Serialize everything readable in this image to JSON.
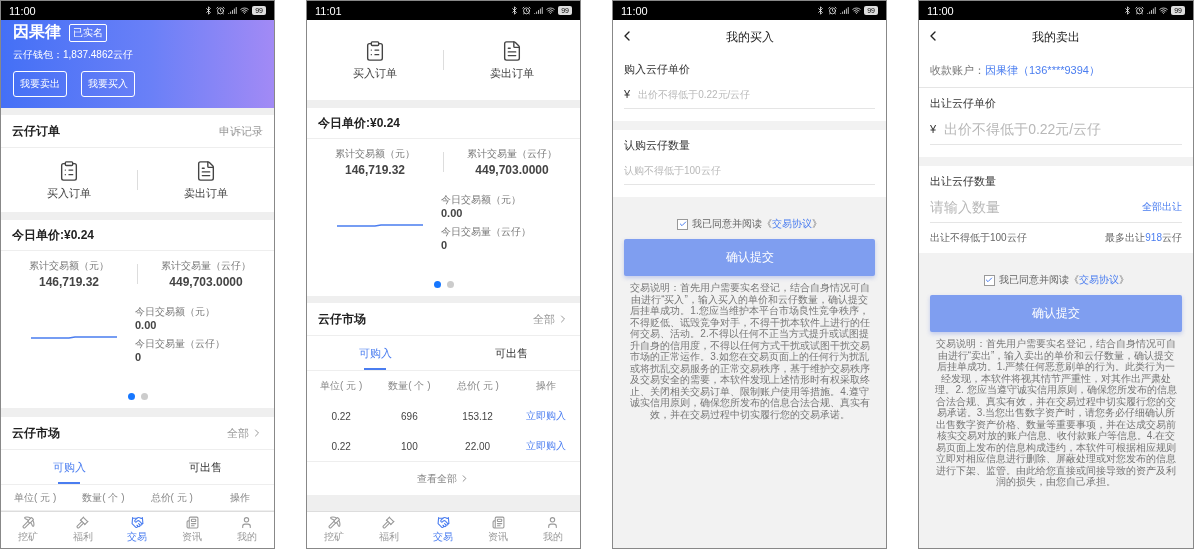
{
  "phones": [
    {
      "kind": "home",
      "time": "11:00",
      "battery": "99",
      "profile": {
        "name": "因果律",
        "badge": "已实名",
        "wallet": "云仔钱包：1,837.4862云仔",
        "buttons": [
          "我要卖出",
          "我要买入"
        ]
      },
      "orders": {
        "title": "云仔订单",
        "link": "申诉记录",
        "items": [
          "买入订单",
          "卖出订单"
        ]
      },
      "price": "今日单价:¥0.24",
      "stats": {
        "totals": [
          {
            "label": "累计交易额（元）",
            "value": "146,719.32"
          },
          {
            "label": "累计交易量（云仔）",
            "value": "449,703.0000"
          }
        ],
        "today": [
          {
            "label": "今日交易额（元）",
            "value": "0.00"
          },
          {
            "label": "今日交易量（云仔）",
            "value": "0"
          }
        ],
        "pager": [
          {
            "selected": true
          },
          {
            "selected": false
          }
        ]
      },
      "market": {
        "title": "云仔市场",
        "link": "全部",
        "tabs": [
          {
            "label": "可购入",
            "selected": true
          },
          {
            "label": "可出售",
            "selected": false
          }
        ],
        "columns": [
          "单位( 元 )",
          "数量( 个 )",
          "总价( 元 )",
          "操作"
        ]
      },
      "tabbar": [
        {
          "label": "挖矿",
          "selected": false
        },
        {
          "label": "福利",
          "selected": false
        },
        {
          "label": "交易",
          "selected": true
        },
        {
          "label": "资讯",
          "selected": false
        },
        {
          "label": "我的",
          "selected": false
        }
      ]
    },
    {
      "kind": "home",
      "time": "11:01",
      "battery": "99",
      "orders": {
        "items": [
          "买入订单",
          "卖出订单"
        ]
      },
      "price": "今日单价:¥0.24",
      "stats": {
        "totals": [
          {
            "label": "累计交易额（元）",
            "value": "146,719.32"
          },
          {
            "label": "累计交易量（云仔）",
            "value": "449,703.0000"
          }
        ],
        "today": [
          {
            "label": "今日交易额（元）",
            "value": "0.00"
          },
          {
            "label": "今日交易量（云仔）",
            "value": "0"
          }
        ],
        "pager": [
          {
            "selected": true
          },
          {
            "selected": false
          }
        ]
      },
      "market": {
        "title": "云仔市场",
        "link": "全部",
        "tabs": [
          {
            "label": "可购入",
            "selected": true
          },
          {
            "label": "可出售",
            "selected": false
          }
        ],
        "columns": [
          "单位( 元 )",
          "数量( 个 )",
          "总价( 元 )",
          "操作"
        ],
        "rows": [
          [
            "0.22",
            "696",
            "153.12",
            "立即购入"
          ],
          [
            "0.22",
            "100",
            "22.00",
            "立即购入"
          ]
        ],
        "view_all": "查看全部"
      },
      "tabbar": [
        {
          "label": "挖矿",
          "selected": false
        },
        {
          "label": "福利",
          "selected": false
        },
        {
          "label": "交易",
          "selected": true
        },
        {
          "label": "资讯",
          "selected": false
        },
        {
          "label": "我的",
          "selected": false
        }
      ]
    },
    {
      "kind": "buy",
      "time": "11:00",
      "battery": "99",
      "title": "我的买入",
      "fields": [
        {
          "label": "购入云仔单价",
          "currency": "¥",
          "placeholder": "出价不得低于0.22元/云仔"
        },
        {
          "label": "认购云仔数量",
          "placeholder": "认购不得低于100云仔"
        }
      ],
      "agreement": {
        "checked": true,
        "text": "我已同意并阅读《",
        "link": "交易协议",
        "close": "》"
      },
      "submit": "确认提交",
      "notice": "交易说明：首先用户需要实名登记，结合自身情况可自由进行“买入”，输入买入的单价和云仔数量，确认提交后挂单成功。1.您应当维护本平台市场良性竞争秩序，不得贬低、诋毁竞争对手，不得干扰本软件上进行的任何交易、活动。2.不得以任何不正当方式提升或试图提升自身的信用度，不得以任何方式干扰或试图干扰交易市场的正常运作。3.如您在交易页面上的任何行为扰乱或将扰乱交易服务的正常交易秩序，基于维护交易秩序及交易安全的需要，本软件发现上述情形时有权采取终止、关闭相关交易订单、限制账户使用等措施。4.遵守诚实信用原则，确保您所发布的信息合法合规、真实有效，并在交易过程中切实履行您的交易承诺。"
    },
    {
      "kind": "sell",
      "time": "11:00",
      "battery": "99",
      "title": "我的卖出",
      "account": {
        "label": "收款账户：",
        "value": "因果律（136****9394）"
      },
      "fields": [
        {
          "label": "出让云仔单价",
          "currency": "¥",
          "placeholder": "出价不得低于0.22元/云仔"
        },
        {
          "label": "出让云仔数量",
          "placeholder": "请输入数量",
          "action": "全部出让",
          "min_hint": "出让不得低于100云仔",
          "max_hint": {
            "prefix": "最多出让",
            "amount": "918",
            "suffix": "云仔"
          }
        }
      ],
      "agreement": {
        "checked": true,
        "text": "我已同意并阅读《",
        "link": "交易协议",
        "close": "》"
      },
      "submit": "确认提交",
      "notice": "交易说明：首先用户需要实名登记，结合自身情况可自由进行“卖出”，输入卖出的单价和云仔数量，确认提交后挂单成功。1.严禁任何恶意刷单的行为。此类行为一经发现，本软件将视其情节严重性，对其作出严肃处理。2. 您应当遵守诚实信用原则，确保您所发布的信息合法合规、真实有效，并在交易过程中切实履行您的交易承诺。3.当您出售数字资产时，请您务必仔细确认所出售数字资产价格、数量等重要事项，并在达成交易前核实交易对放的账户信息、收付款账户等信息。4.在交易页面上发布的信息构成违约，本软件可根据相应规则立即对相应信息进行删除、屏蔽处理或对您发布的信息进行下架、监管。由此给您直接或间接导致的资产及利润的损失，由您自己承担。"
    }
  ]
}
